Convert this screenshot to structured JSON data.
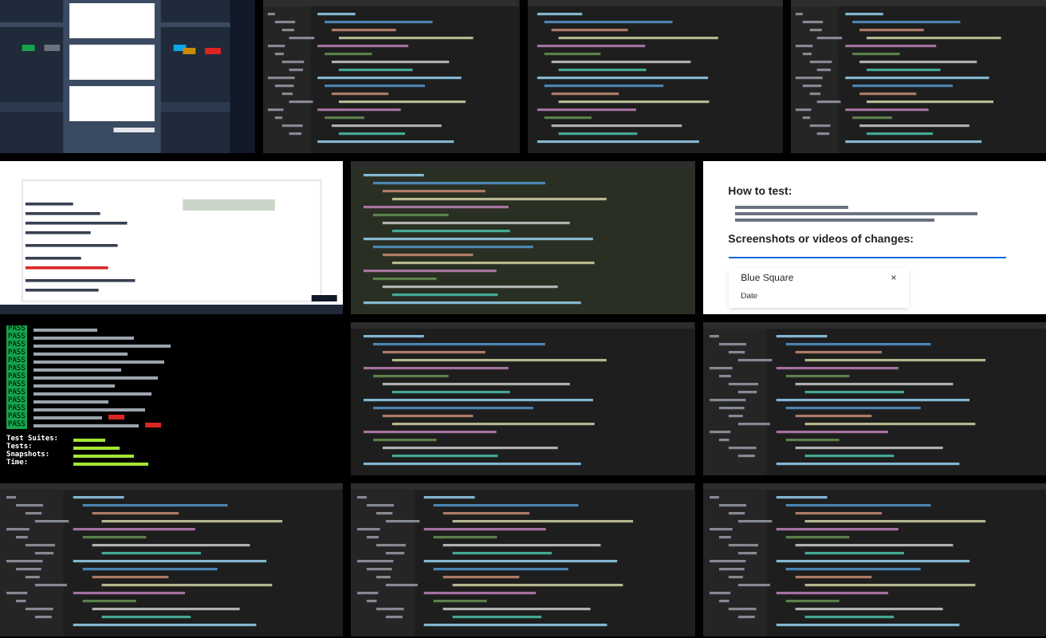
{
  "rows": [
    {
      "tiles": [
        {
          "kind": "dashboard"
        },
        {
          "kind": "editor-sidebar"
        },
        {
          "kind": "editor"
        },
        {
          "kind": "editor-sidebar"
        }
      ]
    },
    {
      "tiles": [
        {
          "kind": "webform"
        },
        {
          "kind": "editor-green"
        },
        {
          "kind": "pr",
          "headings": [
            "How to test:",
            "Screenshots or videos of changes:"
          ],
          "dialog_title": "Blue Square",
          "close": "×",
          "field_label": "Date"
        }
      ]
    },
    {
      "tiles": [
        {
          "kind": "terminal",
          "results": [
            {
              "status": "PASS",
              "slow": false
            },
            {
              "status": "PASS",
              "slow": false
            },
            {
              "status": "PASS",
              "slow": false
            },
            {
              "status": "PASS",
              "slow": false
            },
            {
              "status": "PASS",
              "slow": false
            },
            {
              "status": "PASS",
              "slow": false
            },
            {
              "status": "PASS",
              "slow": false
            },
            {
              "status": "PASS",
              "slow": false
            },
            {
              "status": "PASS",
              "slow": false
            },
            {
              "status": "PASS",
              "slow": false
            },
            {
              "status": "PASS",
              "slow": false
            },
            {
              "status": "PASS",
              "slow": true
            },
            {
              "status": "PASS",
              "slow": true
            }
          ],
          "summary": [
            "Test Suites:",
            "Tests:",
            "Snapshots:",
            "Time:"
          ]
        },
        {
          "kind": "editor"
        },
        {
          "kind": "editor-sidebar"
        }
      ]
    },
    {
      "tiles": [
        {
          "kind": "editor-sidebar"
        },
        {
          "kind": "editor-sidebar"
        },
        {
          "kind": "editor-sidebar"
        }
      ]
    }
  ]
}
